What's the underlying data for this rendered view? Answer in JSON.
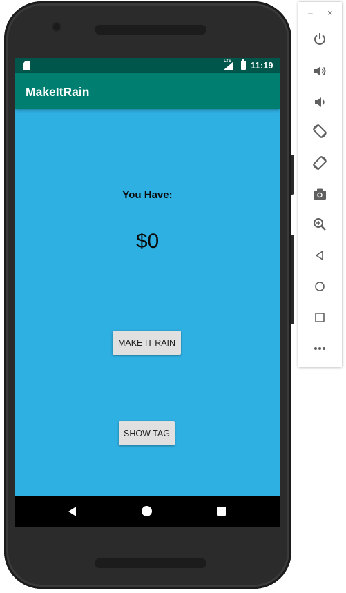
{
  "status_bar": {
    "time": "11:19",
    "network_label": "LTE",
    "icons": [
      "sd-card-icon",
      "lte-signal-icon",
      "battery-charging-icon"
    ]
  },
  "app_bar": {
    "title": "MakeItRain"
  },
  "main": {
    "label": "You Have:",
    "amount": "$0",
    "make_it_rain_button": "MAKE IT RAIN",
    "show_tag_button": "SHOW TAG"
  },
  "colors": {
    "background": "#2fb0e3",
    "app_bar": "#007f70",
    "status_bar": "#00564a",
    "button": "#e0e0e0"
  },
  "nav_bar": {
    "buttons": [
      "back-icon",
      "home-icon",
      "recents-icon"
    ]
  },
  "emulator_toolbar": {
    "window_controls": {
      "minimize": "–",
      "close": "×"
    },
    "buttons": [
      "power-icon",
      "volume-up-icon",
      "volume-down-icon",
      "rotate-left-icon",
      "rotate-right-icon",
      "camera-icon",
      "zoom-icon",
      "back-triangle-icon",
      "home-circle-icon",
      "overview-square-icon",
      "more-icon"
    ]
  }
}
